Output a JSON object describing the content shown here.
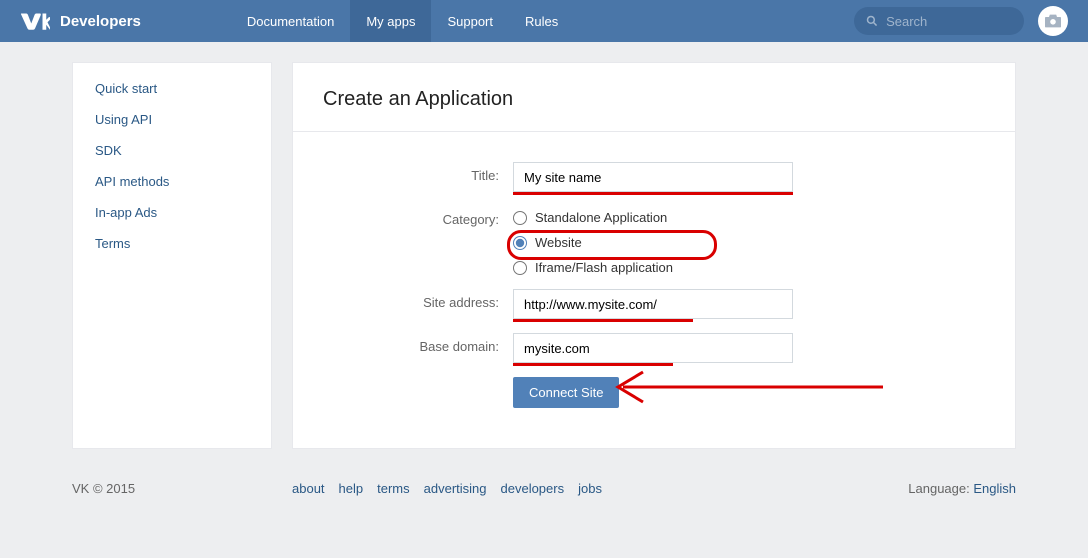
{
  "header": {
    "brand": "Developers",
    "nav": [
      {
        "label": "Documentation",
        "active": false
      },
      {
        "label": "My apps",
        "active": true
      },
      {
        "label": "Support",
        "active": false
      },
      {
        "label": "Rules",
        "active": false
      }
    ],
    "search_placeholder": "Search"
  },
  "sidebar": {
    "items": [
      {
        "label": "Quick start"
      },
      {
        "label": "Using API"
      },
      {
        "label": "SDK"
      },
      {
        "label": "API methods"
      },
      {
        "label": "In-app Ads"
      },
      {
        "label": "Terms"
      }
    ]
  },
  "main": {
    "title": "Create an Application",
    "form": {
      "title_label": "Title:",
      "title_value": "My site name",
      "category_label": "Category:",
      "category_options": [
        {
          "label": "Standalone Application",
          "checked": false
        },
        {
          "label": "Website",
          "checked": true
        },
        {
          "label": "Iframe/Flash application",
          "checked": false
        }
      ],
      "site_address_label": "Site address:",
      "site_address_value": "http://www.mysite.com/",
      "base_domain_label": "Base domain:",
      "base_domain_value": "mysite.com",
      "submit_label": "Connect Site"
    }
  },
  "footer": {
    "copyright": "VK © 2015",
    "links": [
      {
        "label": "about"
      },
      {
        "label": "help"
      },
      {
        "label": "terms"
      },
      {
        "label": "advertising"
      },
      {
        "label": "developers"
      },
      {
        "label": "jobs"
      }
    ],
    "language_label": "Language:",
    "language_value": "English"
  }
}
